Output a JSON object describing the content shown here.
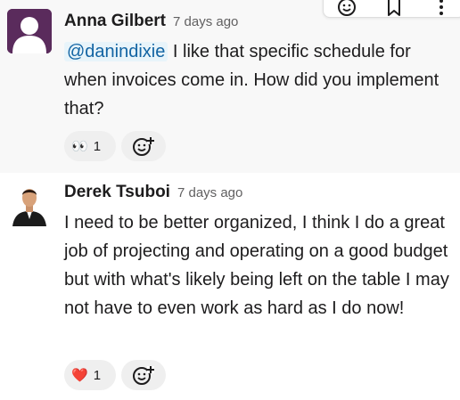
{
  "messages": [
    {
      "author": "Anna Gilbert",
      "time": "7 days ago",
      "mention": "@danindixie",
      "text_after_mention": " I like that specific schedule for when invoices come in. How did you implement that?",
      "reactions": [
        {
          "emoji": "👀",
          "count": "1"
        }
      ]
    },
    {
      "author": "Derek Tsuboi",
      "time": "7 days ago",
      "text": "I need to be better organized, I think I do a great job of projecting and operating on a good budget but with what's likely being left on the table I may not have to even work as hard as I do now!",
      "reactions": [
        {
          "emoji": "❤️",
          "count": "1"
        }
      ]
    }
  ],
  "toolbar": {
    "icons": [
      "emoji-icon",
      "bookmark-icon",
      "more-icon"
    ]
  },
  "colors": {
    "mention_bg": "#e8f4fa",
    "mention_text": "#1264a3",
    "heart": "#e0245e"
  }
}
